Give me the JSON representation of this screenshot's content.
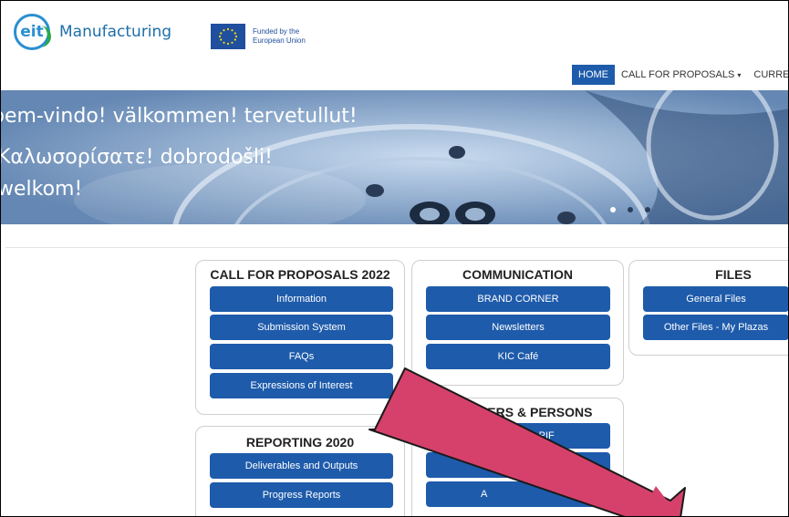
{
  "header": {
    "logo_mark": "eit",
    "logo_text": "Manufacturing",
    "eu_line1": "Funded by the",
    "eu_line2": "European Union"
  },
  "nav": {
    "home": "HOME",
    "call": "CALL FOR PROPOSALS",
    "call_caret": "▾",
    "current": "CURRENT"
  },
  "hero": {
    "line1": "bem-vindo! välkommen! tervetullut!",
    "line2": "Καλωσορίσατε! dobrodošli!",
    "line3": "welkom!"
  },
  "panels": {
    "call": {
      "title": "CALL FOR PROPOSALS 2022",
      "b1": "Information",
      "b2": "Submission System",
      "b3": "FAQs",
      "b4": "Expressions of Interest"
    },
    "communication": {
      "title": "COMMUNICATION",
      "b1": "BRAND CORNER",
      "b2": "Newsletters",
      "b3": "KIC Café"
    },
    "files": {
      "title": "FILES",
      "b1": "General Files",
      "b2": "Other Files - My Plazas"
    },
    "partners": {
      "title": "RTNERS & PERSONS",
      "b1": "ation Form - PIF",
      "b3": "A"
    },
    "reporting": {
      "title": "REPORTING 2020",
      "b1": "Deliverables and Outputs",
      "b2": "Progress Reports"
    }
  },
  "colors": {
    "primary_button": "#1e5bab",
    "annotation_arrow": "#d6416b"
  }
}
